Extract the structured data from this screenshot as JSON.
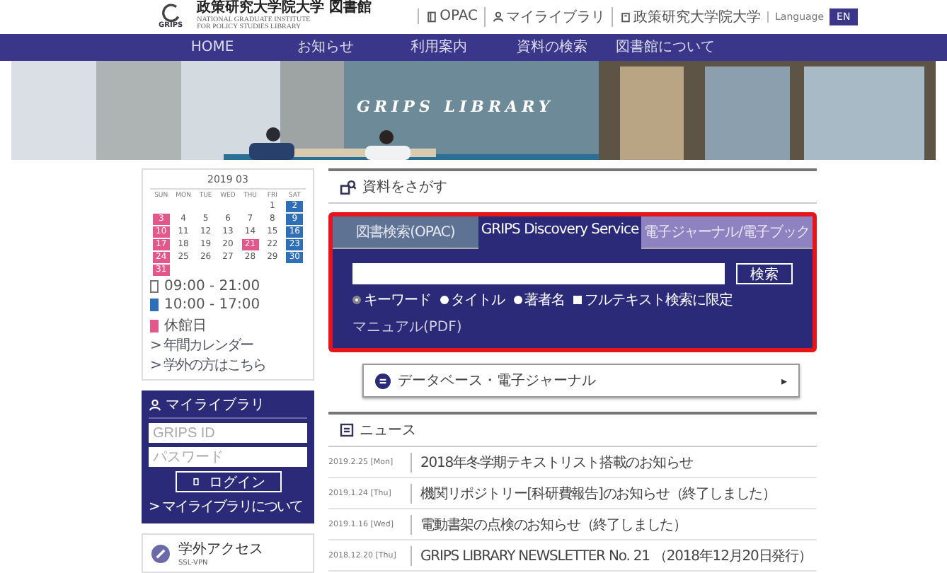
{
  "header": {
    "title": "政策研究大学院大学 図書館",
    "subtitle_lines": [
      "NATIONAL GRADUATE INSTITUTE",
      "FOR POLICY STUDIES LIBRARY"
    ],
    "logo_text": "GRIPS",
    "links": [
      {
        "label": "OPAC",
        "kind": "book"
      },
      {
        "label": "マイライブラリ",
        "kind": "person"
      },
      {
        "label": "政策研究大学院大学",
        "kind": "building"
      }
    ],
    "language": "Language",
    "language_button": "EN"
  },
  "nav": [
    "HOME",
    "お知らせ",
    "利用案内",
    "資料の検索",
    "図書館について"
  ],
  "banner": {
    "title": "GRIPS LIBRARY"
  },
  "calendar": {
    "title": "2019 03",
    "weekdays": [
      "SUN",
      "MON",
      "TUE",
      "WED",
      "THU",
      "FRI",
      "SAT"
    ],
    "weeks": [
      [
        {
          "label": "1",
          "kind": "open"
        },
        {
          "label": "2",
          "kind": "short"
        }
      ],
      [
        {
          "label": "3",
          "kind": "closed"
        },
        {
          "label": "4",
          "kind": "open"
        },
        {
          "label": "5",
          "kind": "open"
        },
        {
          "label": "6",
          "kind": "open"
        },
        {
          "label": "7",
          "kind": "open"
        },
        {
          "label": "8",
          "kind": "open"
        },
        {
          "label": "9",
          "kind": "short"
        }
      ],
      [
        {
          "label": "10",
          "kind": "closed"
        },
        {
          "label": "11",
          "kind": "open"
        },
        {
          "label": "12",
          "kind": "open"
        },
        {
          "label": "13",
          "kind": "open"
        },
        {
          "label": "14",
          "kind": "open"
        },
        {
          "label": "15",
          "kind": "open"
        },
        {
          "label": "16",
          "kind": "short"
        }
      ],
      [
        {
          "label": "17",
          "kind": "closed"
        },
        {
          "label": "18",
          "kind": "open"
        },
        {
          "label": "19",
          "kind": "open"
        },
        {
          "label": "20",
          "kind": "open"
        },
        {
          "label": "21",
          "kind": "closed"
        },
        {
          "label": "22",
          "kind": "open"
        },
        {
          "label": "23",
          "kind": "short"
        }
      ],
      [
        {
          "label": "24",
          "kind": "closed"
        },
        {
          "label": "25",
          "kind": "open"
        },
        {
          "label": "26",
          "kind": "open"
        },
        {
          "label": "27",
          "kind": "open"
        },
        {
          "label": "28",
          "kind": "open"
        },
        {
          "label": "29",
          "kind": "open"
        },
        {
          "label": "30",
          "kind": "short"
        }
      ],
      [
        {
          "label": "31",
          "kind": "closed"
        }
      ]
    ],
    "legend": [
      {
        "kind": "open",
        "label": "09:00 - 21:00"
      },
      {
        "kind": "short",
        "label": "10:00 - 17:00"
      },
      {
        "kind": "closed",
        "label": "休館日"
      }
    ],
    "links": [
      "> 年間カレンダー",
      "> 学外の方はこちら"
    ]
  },
  "my_library": {
    "title": "マイライブラリ",
    "id_placeholder": "GRIPS ID",
    "password_placeholder": "パスワード",
    "login_button": "ログイン",
    "link": "> マイライブラリについて"
  },
  "remote_access": {
    "title": "学外アクセス",
    "subtitle": "SSL-VPN"
  },
  "search": {
    "heading": "資料をさがす",
    "tabs": [
      {
        "label": "図書検索(OPAC)",
        "selected": false
      },
      {
        "label": "GRIPS Discovery Service",
        "selected": true
      },
      {
        "label": "電子ジャーナル/電子ブック",
        "selected": false
      }
    ],
    "button": "検索",
    "options": [
      {
        "kind": "radio",
        "label": "キーワード",
        "selected": true
      },
      {
        "kind": "radio",
        "label": "タイトル",
        "selected": false
      },
      {
        "kind": "radio",
        "label": "著者名",
        "selected": false
      },
      {
        "kind": "checkbox",
        "label": "フルテキスト検索に限定",
        "selected": false
      }
    ],
    "manual": "マニュアル(PDF)"
  },
  "database_bar": {
    "label": "データベース・電子ジャーナル",
    "arrow": "▸"
  },
  "news": {
    "heading": "ニュース",
    "rows": [
      {
        "date": "2019.2.25 [Mon]",
        "title": "2018年冬学期テキストリスト搭載のお知らせ"
      },
      {
        "date": "2019.1.24 [Thu]",
        "title": "機関リポジトリー[科研費報告]のお知らせ（終了しました）"
      },
      {
        "date": "2019.1.16 [Wed]",
        "title": "電動書架の点検のお知らせ（終了しました）"
      },
      {
        "date": "2018.12.20 [Thu]",
        "title": "GRIPS LIBRARY NEWSLETTER No. 21 （2018年12月20日発行）"
      }
    ]
  }
}
